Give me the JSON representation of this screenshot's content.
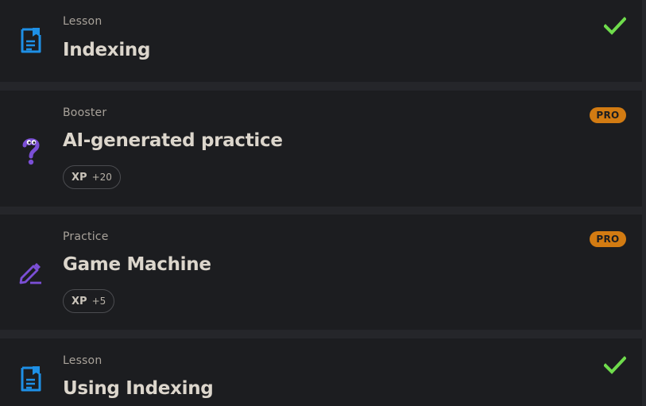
{
  "items": [
    {
      "type": "Lesson",
      "title": "Indexing",
      "icon": "lesson-doc-icon",
      "status": "completed"
    },
    {
      "type": "Booster",
      "title": "AI-generated practice",
      "icon": "question-mark-icon",
      "badge": "PRO",
      "xp_label": "XP",
      "xp_value": "+20"
    },
    {
      "type": "Practice",
      "title": "Game Machine",
      "icon": "pencil-edit-icon",
      "badge": "PRO",
      "xp_label": "XP",
      "xp_value": "+5"
    },
    {
      "type": "Lesson",
      "title": "Using Indexing",
      "icon": "lesson-doc-icon",
      "status": "completed"
    }
  ],
  "colors": {
    "lesson_icon": "#1e90e6",
    "booster_icon": "#7b4fd6",
    "practice_icon": "#7b4fd6",
    "check": "#6fdc4c",
    "pro_badge": "#d27b12",
    "card_bg": "#1c1d20",
    "gap_bg": "#25262a"
  }
}
